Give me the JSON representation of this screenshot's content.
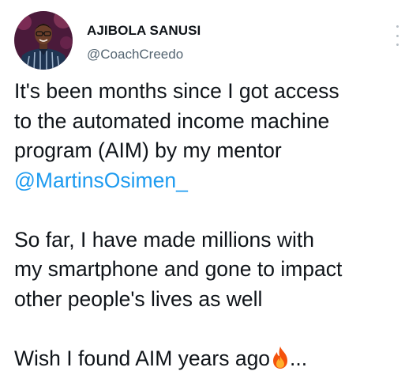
{
  "author": {
    "display_name": "AJIBOLA SANUSI",
    "handle": "@CoachCreedo",
    "avatar_icon": "person-photo"
  },
  "menu": {
    "icon": "more-vertical-icon"
  },
  "tweet": {
    "paragraph1": {
      "line1": "It's been months since I got access",
      "line2": "to the automated income machine",
      "line3": "program (AIM) by my mentor",
      "mention": "@MartinsOsimen_"
    },
    "paragraph2": {
      "line1": "So far, I have made millions with",
      "line2": "my smartphone and gone to impact",
      "line3": "other people's lives as well"
    },
    "paragraph3": {
      "text": "Wish I found AIM years ago",
      "emoji": "fire-icon",
      "trailing": "..."
    }
  },
  "colors": {
    "text": "#0f1419",
    "secondary": "#536471",
    "link": "#1d9bf0"
  }
}
